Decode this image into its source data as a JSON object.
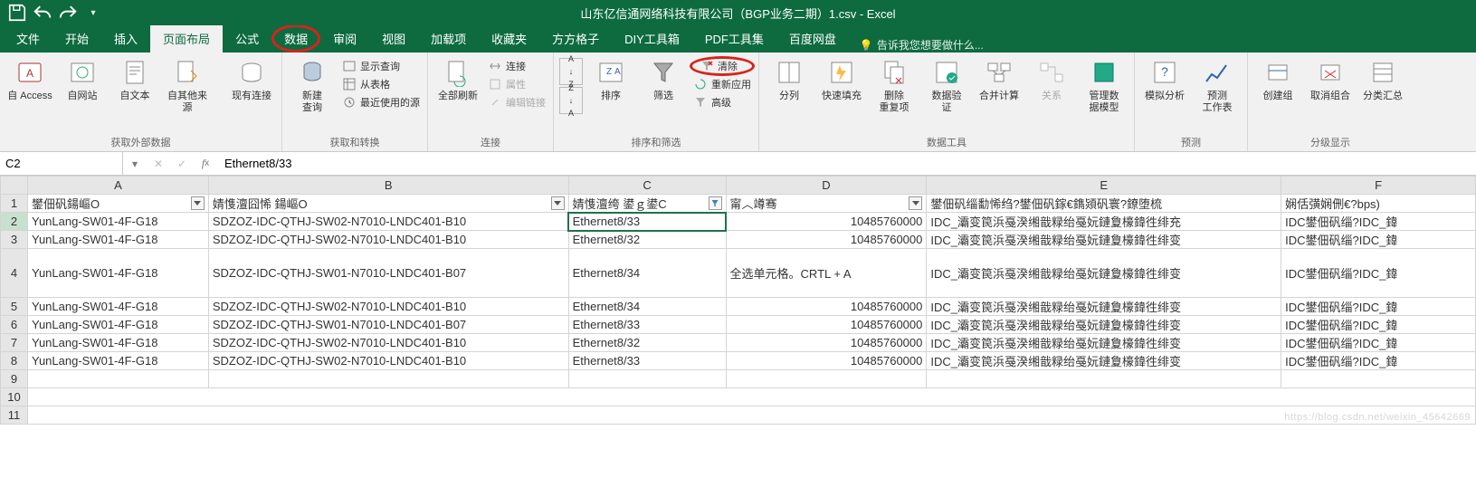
{
  "title": "山东亿信通网络科技有限公司（BGP业务二期）1.csv - Excel",
  "tabs": {
    "file": "文件",
    "home": "开始",
    "insert": "插入",
    "page": "页面布局",
    "formula": "公式",
    "data": "数据",
    "review": "审阅",
    "view": "视图",
    "addin": "加载项",
    "fav": "收藏夹",
    "fang": "方方格子",
    "diy": "DIY工具箱",
    "pdf": "PDF工具集",
    "baidu": "百度网盘"
  },
  "tellme": "告诉我您想要做什么...",
  "ribbon": {
    "ext": {
      "access": "自 Access",
      "web": "自网站",
      "text": "自文本",
      "other": "自其他来源",
      "existing": "现有连接",
      "label": "获取外部数据"
    },
    "get": {
      "new": "新建\n查询",
      "show": "显示查询",
      "table": "从表格",
      "recent": "最近使用的源",
      "label": "获取和转换"
    },
    "conn": {
      "refresh": "全部刷新",
      "conn": "连接",
      "prop": "属性",
      "edit": "编辑链接",
      "label": "连接"
    },
    "sort": {
      "sort": "排序",
      "filter": "筛选",
      "clear": "清除",
      "reapply": "重新应用",
      "adv": "高级",
      "label": "排序和筛选"
    },
    "tools": {
      "split": "分列",
      "flash": "快速填充",
      "dup": "删除\n重复项",
      "valid": "数据验\n证",
      "consol": "合并计算",
      "rel": "关系",
      "model": "管理数\n据模型",
      "label": "数据工具"
    },
    "forecast": {
      "what": "模拟分析",
      "fcst": "预测\n工作表",
      "label": "预测"
    },
    "outline": {
      "group": "创建组",
      "ungroup": "取消组合",
      "subtotal": "分类汇总",
      "label": "分级显示"
    }
  },
  "az": "A",
  "za": "Z",
  "namebox": "C2",
  "formula": "Ethernet8/33",
  "columns": [
    "A",
    "B",
    "C",
    "D",
    "E",
    "F"
  ],
  "headers": {
    "A": "鐢佃矾鍚嶇О",
    "B": "婧愯澶囧悕    鍚嶇О",
    "C": "婧愯澶绔    鍙ｇ鍙C",
    "D": "甯︿竴骞",
    "E": "鐢佃矾缁勫悕绉?鐢佃矾鎵€鐫熲矾寰?鐐堕梳",
    "F": "娴佸彉娴侀€?bps)"
  },
  "rows": [
    {
      "n": "2",
      "A": "YunLang-SW01-4F-G18",
      "B": "SDZOZ-IDC-QTHJ-SW02-N7010-LNDC401-B10",
      "C": "Ethernet8/33",
      "D": "10485760000",
      "E": "IDC_灞变笢浜戞湀缃戠粶绐戞妧鏈夐檺鍏徃绯充",
      "F": "IDC鐢佃矾缁?IDC_鍏"
    },
    {
      "n": "3",
      "A": "YunLang-SW01-4F-G18",
      "B": "SDZOZ-IDC-QTHJ-SW02-N7010-LNDC401-B10",
      "C": "Ethernet8/32",
      "D": "10485760000",
      "E": "IDC_灞变笢浜戞湀缃戠粶绐戞妧鏈夐檺鍏徃绯变",
      "F": "IDC鐢佃矾缁?IDC_鍏"
    },
    {
      "n": "4",
      "A": "YunLang-SW01-4F-G18",
      "B": "SDZOZ-IDC-QTHJ-SW01-N7010-LNDC401-B07",
      "C": "Ethernet8/34",
      "D": "全选单元格。CRTL + A",
      "E": "IDC_灞变笢浜戞湀缃戠粶绐戞妧鏈夐檺鍏徃绯变",
      "F": "IDC鐢佃矾缁?IDC_鍏",
      "tall": true,
      "dtext": true
    },
    {
      "n": "5",
      "A": "YunLang-SW01-4F-G18",
      "B": "SDZOZ-IDC-QTHJ-SW02-N7010-LNDC401-B10",
      "C": "Ethernet8/34",
      "D": "10485760000",
      "E": "IDC_灞变笢浜戞湀缃戠粶绐戞妧鏈夐檺鍏徃绯变",
      "F": "IDC鐢佃矾缁?IDC_鍏"
    },
    {
      "n": "6",
      "A": "YunLang-SW01-4F-G18",
      "B": "SDZOZ-IDC-QTHJ-SW01-N7010-LNDC401-B07",
      "C": "Ethernet8/33",
      "D": "10485760000",
      "E": "IDC_灞变笢浜戞湀缃戠粶绐戞妧鏈夐檺鍏徃绯变",
      "F": "IDC鐢佃矾缁?IDC_鍏"
    },
    {
      "n": "7",
      "A": "YunLang-SW01-4F-G18",
      "B": "SDZOZ-IDC-QTHJ-SW02-N7010-LNDC401-B10",
      "C": "Ethernet8/32",
      "D": "10485760000",
      "E": "IDC_灞变笢浜戞湀缃戠粶绐戞妧鏈夐檺鍏徃绯变",
      "F": "IDC鐢佃矾缁?IDC_鍏"
    },
    {
      "n": "8",
      "A": "YunLang-SW01-4F-G18",
      "B": "SDZOZ-IDC-QTHJ-SW02-N7010-LNDC401-B10",
      "C": "Ethernet8/33",
      "D": "10485760000",
      "E": "IDC_灞变笢浜戞湀缃戠粶绐戞妧鏈夐檺鍏徃绯变",
      "F": "IDC鐢佃矾缁?IDC_鍏"
    },
    {
      "n": "9",
      "A": "",
      "B": "",
      "C": "",
      "D": "",
      "E": "",
      "F": ""
    }
  ],
  "row10": "10",
  "row11": "11",
  "watermark": "https://blog.csdn.net/weixin_45642669"
}
